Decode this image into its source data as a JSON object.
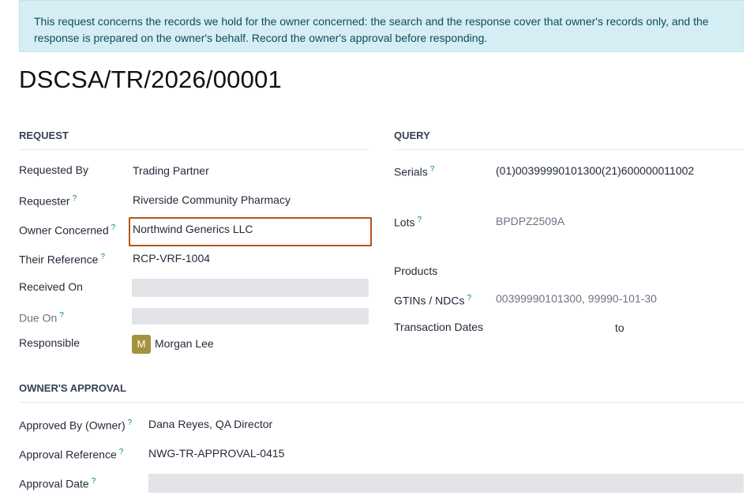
{
  "alert": {
    "line1": "This request concerns the records we hold for the owner concerned: the search and the response cover that owner's records only, and the",
    "line2": "response is prepared on the owner's behalf. Record the owner's approval before responding."
  },
  "title": "DSCSA/TR/2026/00001",
  "request": {
    "heading": "REQUEST",
    "requested_by": {
      "label": "Requested By",
      "value": "Trading Partner"
    },
    "requester": {
      "label": "Requester",
      "help": "?",
      "value": "Riverside Community Pharmacy"
    },
    "owner_concerned": {
      "label": "Owner Concerned",
      "help": "?",
      "value": "Northwind Generics LLC"
    },
    "their_reference": {
      "label": "Their Reference",
      "help": "?",
      "value": "RCP-VRF-1004"
    },
    "received_on": {
      "label": "Received On",
      "value": ""
    },
    "due_on": {
      "label": "Due On",
      "help": "?",
      "value": ""
    },
    "responsible": {
      "label": "Responsible",
      "avatar": "M",
      "value": "Morgan Lee"
    }
  },
  "query": {
    "heading": "QUERY",
    "serials": {
      "label": "Serials",
      "help": "?",
      "value": "(01)00399990101300(21)600000011002"
    },
    "lots": {
      "label": "Lots",
      "help": "?",
      "value": "BPDPZ2509A"
    },
    "products": {
      "label": "Products"
    },
    "gtins": {
      "label": "GTINs / NDCs",
      "help": "?",
      "value": "00399990101300, 99990-101-30"
    },
    "transaction_dates": {
      "label": "Transaction Dates",
      "separator": "to"
    }
  },
  "approval": {
    "heading": "OWNER'S APPROVAL",
    "approved_by": {
      "label": "Approved By (Owner)",
      "help": "?",
      "value": "Dana Reyes, QA Director"
    },
    "approval_reference": {
      "label": "Approval Reference",
      "help": "?",
      "value": "NWG-TR-APPROVAL-0415"
    },
    "approval_date": {
      "label": "Approval Date",
      "help": "?",
      "value": ""
    }
  }
}
